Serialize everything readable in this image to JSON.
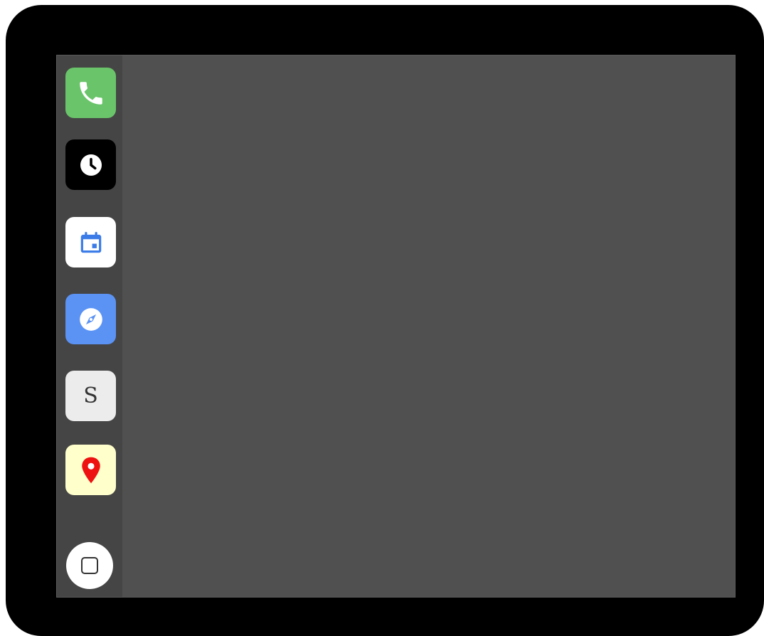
{
  "dock": {
    "apps": [
      {
        "id": "phone",
        "icon": "phone-icon",
        "background": "#6ac46a"
      },
      {
        "id": "clock",
        "icon": "clock-icon",
        "background": "#000000"
      },
      {
        "id": "calendar",
        "icon": "calendar-icon",
        "background": "#ffffff",
        "accent": "#3a7be8"
      },
      {
        "id": "browser",
        "icon": "compass-icon",
        "background": "#5b93f5"
      },
      {
        "id": "s-app",
        "icon": "letter-s-icon",
        "background": "#ececec",
        "letter": "S"
      },
      {
        "id": "maps",
        "icon": "map-pin-icon",
        "background": "#ffffcc",
        "accent": "#ee1111"
      }
    ],
    "home": {
      "icon": "home-square-icon"
    }
  },
  "colors": {
    "bezel": "#000000",
    "screen": "#505050",
    "dock": "#454545"
  }
}
